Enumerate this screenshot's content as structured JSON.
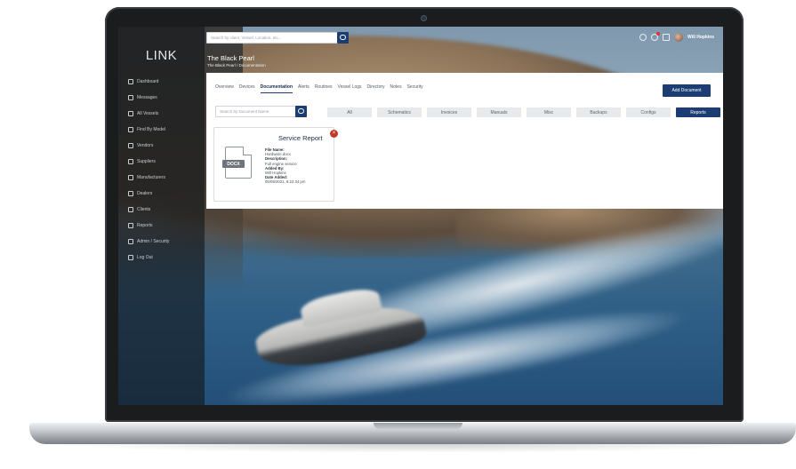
{
  "app": {
    "logo": "LINK"
  },
  "sidebar": {
    "items": [
      {
        "label": "Dashboard",
        "icon": "dashboard-icon"
      },
      {
        "label": "Messages",
        "icon": "messages-icon"
      },
      {
        "label": "All Vessels",
        "icon": "vessels-icon"
      },
      {
        "label": "Find By Model",
        "icon": "search-icon"
      },
      {
        "label": "Vendors",
        "icon": "vendors-icon"
      },
      {
        "label": "Suppliers",
        "icon": "suppliers-icon"
      },
      {
        "label": "Manufacturers",
        "icon": "manufacturers-icon"
      },
      {
        "label": "Dealers",
        "icon": "dealers-icon"
      },
      {
        "label": "Clients",
        "icon": "clients-icon"
      },
      {
        "label": "Reports",
        "icon": "reports-icon"
      },
      {
        "label": "Admin / Security",
        "icon": "admin-icon"
      },
      {
        "label": "Log Out",
        "icon": "logout-icon"
      }
    ]
  },
  "topbar": {
    "search_placeholder": "Search by client, Vessel, Location, etc...",
    "user_name": "Will Hopkins"
  },
  "page": {
    "title": "The Black Pearl",
    "breadcrumb": "The Black Pearl / Documentation"
  },
  "tabs": [
    {
      "label": "Overview",
      "active": false
    },
    {
      "label": "Devices",
      "active": false
    },
    {
      "label": "Documentation",
      "active": true
    },
    {
      "label": "Alerts",
      "active": false
    },
    {
      "label": "Routines",
      "active": false
    },
    {
      "label": "Vessel Logs",
      "active": false
    },
    {
      "label": "Directory",
      "active": false
    },
    {
      "label": "Notes",
      "active": false
    },
    {
      "label": "Security",
      "active": false
    }
  ],
  "actions": {
    "add_document": "Add Document"
  },
  "documents": {
    "search_placeholder": "Search by Document Name",
    "filters": [
      "All",
      "Schematics",
      "Invoices",
      "Manuals",
      "Misc",
      "Backups",
      "Configs",
      "Reports"
    ],
    "active_filter": "Reports",
    "card": {
      "title": "Service Report",
      "file_type": "DOCX",
      "file_name_label": "File Name:",
      "file_name": "Hardware.docx",
      "description_label": "Description:",
      "description": "Full engine service",
      "added_by_label": "Added By:",
      "added_by": "Will Hopkins",
      "date_added_label": "Date Added:",
      "date_added": "05/09/2021, 6:22:34 pm"
    }
  },
  "colors": {
    "accent": "#1b3d73",
    "close": "#c0392b"
  }
}
